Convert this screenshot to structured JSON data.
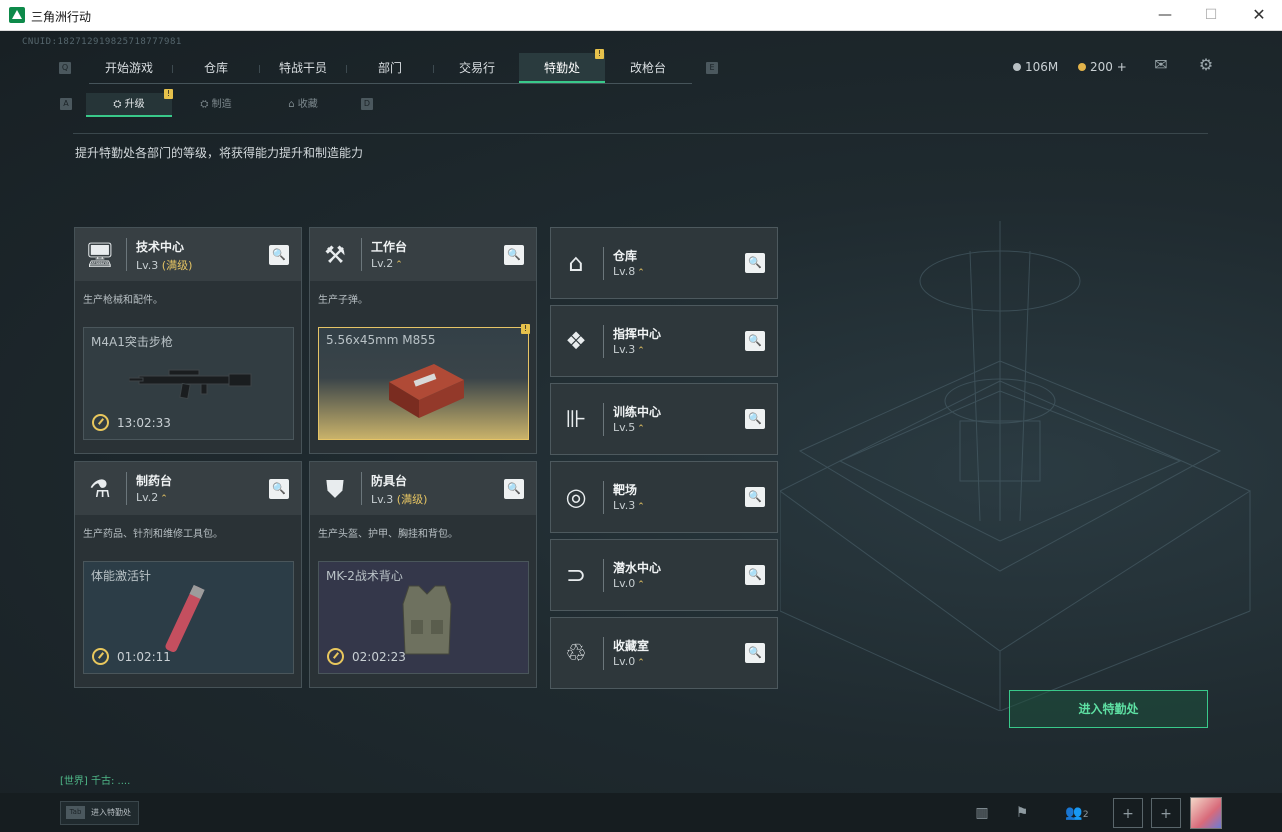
{
  "window": {
    "title": "三角洲行动",
    "minimize": "—",
    "maximize": "☐",
    "close": "✕"
  },
  "uid": "CNUID:1827129198257187779​81",
  "nav": {
    "left_key": "Q",
    "right_key": "E",
    "tabs": [
      {
        "label": "开始游戏"
      },
      {
        "label": "仓库"
      },
      {
        "label": "特战干员"
      },
      {
        "label": "部门"
      },
      {
        "label": "交易行"
      },
      {
        "label": "特勤处",
        "badge": "!"
      },
      {
        "label": "改枪台"
      }
    ]
  },
  "currency": {
    "silver": "106M",
    "gold": "200 +"
  },
  "subnav": {
    "left_key": "A",
    "right_key": "D",
    "tabs": [
      {
        "label": "升级",
        "icon": "⛭",
        "badge": "!"
      },
      {
        "label": "制造",
        "icon": "⛭"
      },
      {
        "label": "收藏",
        "icon": "⌂"
      }
    ]
  },
  "description": "提升特勤处各部门的等级，将获得能力提升和制造能力",
  "departments": [
    {
      "name": "技术中心",
      "level": "Lv.3",
      "max_label": "(满级)",
      "icon": "computer-icon",
      "glyph": "🖥",
      "sub": "生产枪械和配件。",
      "product": {
        "name": "M4A1突击步枪",
        "time": "13:02:33"
      }
    },
    {
      "name": "工作台",
      "level": "Lv.2",
      "up": "⌃",
      "icon": "tools-icon",
      "glyph": "⚒",
      "sub": "生产子弹。",
      "product": {
        "name": "5.56x45mm M855",
        "time": "",
        "badge": "!"
      }
    },
    {
      "name": "制药台",
      "level": "Lv.2",
      "up": "⌃",
      "icon": "microscope-icon",
      "glyph": "⚗",
      "sub": "生产药品、针剂和维修工具包。",
      "product": {
        "name": "体能激活针",
        "time": "01:02:11"
      }
    },
    {
      "name": "防具台",
      "level": "Lv.3",
      "max_label": "(满级)",
      "icon": "armor-icon",
      "glyph": "⛊",
      "sub": "生产头盔、护甲、胸挂和背包。",
      "product": {
        "name": "MK-2战术背心",
        "time": "02:02:23"
      }
    }
  ],
  "facilities": [
    {
      "name": "仓库",
      "level": "Lv.8",
      "up": "⌃",
      "glyph": "⌂"
    },
    {
      "name": "指挥中心",
      "level": "Lv.3",
      "up": "⌃",
      "glyph": "❖"
    },
    {
      "name": "训练中心",
      "level": "Lv.5",
      "up": "⌃",
      "glyph": "⊪"
    },
    {
      "name": "靶场",
      "level": "Lv.3",
      "up": "⌃",
      "glyph": "◎"
    },
    {
      "name": "潜水中心",
      "level": "Lv.0",
      "up": "⌃",
      "glyph": "⊃"
    },
    {
      "name": "收藏室",
      "level": "Lv.0",
      "up": "⌃",
      "glyph": "♲"
    }
  ],
  "enter_button": "进入特勤处",
  "chat": "[世界] 千古: ....",
  "bottom": {
    "tab_key": "Tab",
    "tab_label": "进入特勤处",
    "squad_count": "2",
    "plus": "+"
  },
  "colors": {
    "accent": "#39c98a",
    "gold": "#e5c463",
    "bg": "#1b2327"
  }
}
